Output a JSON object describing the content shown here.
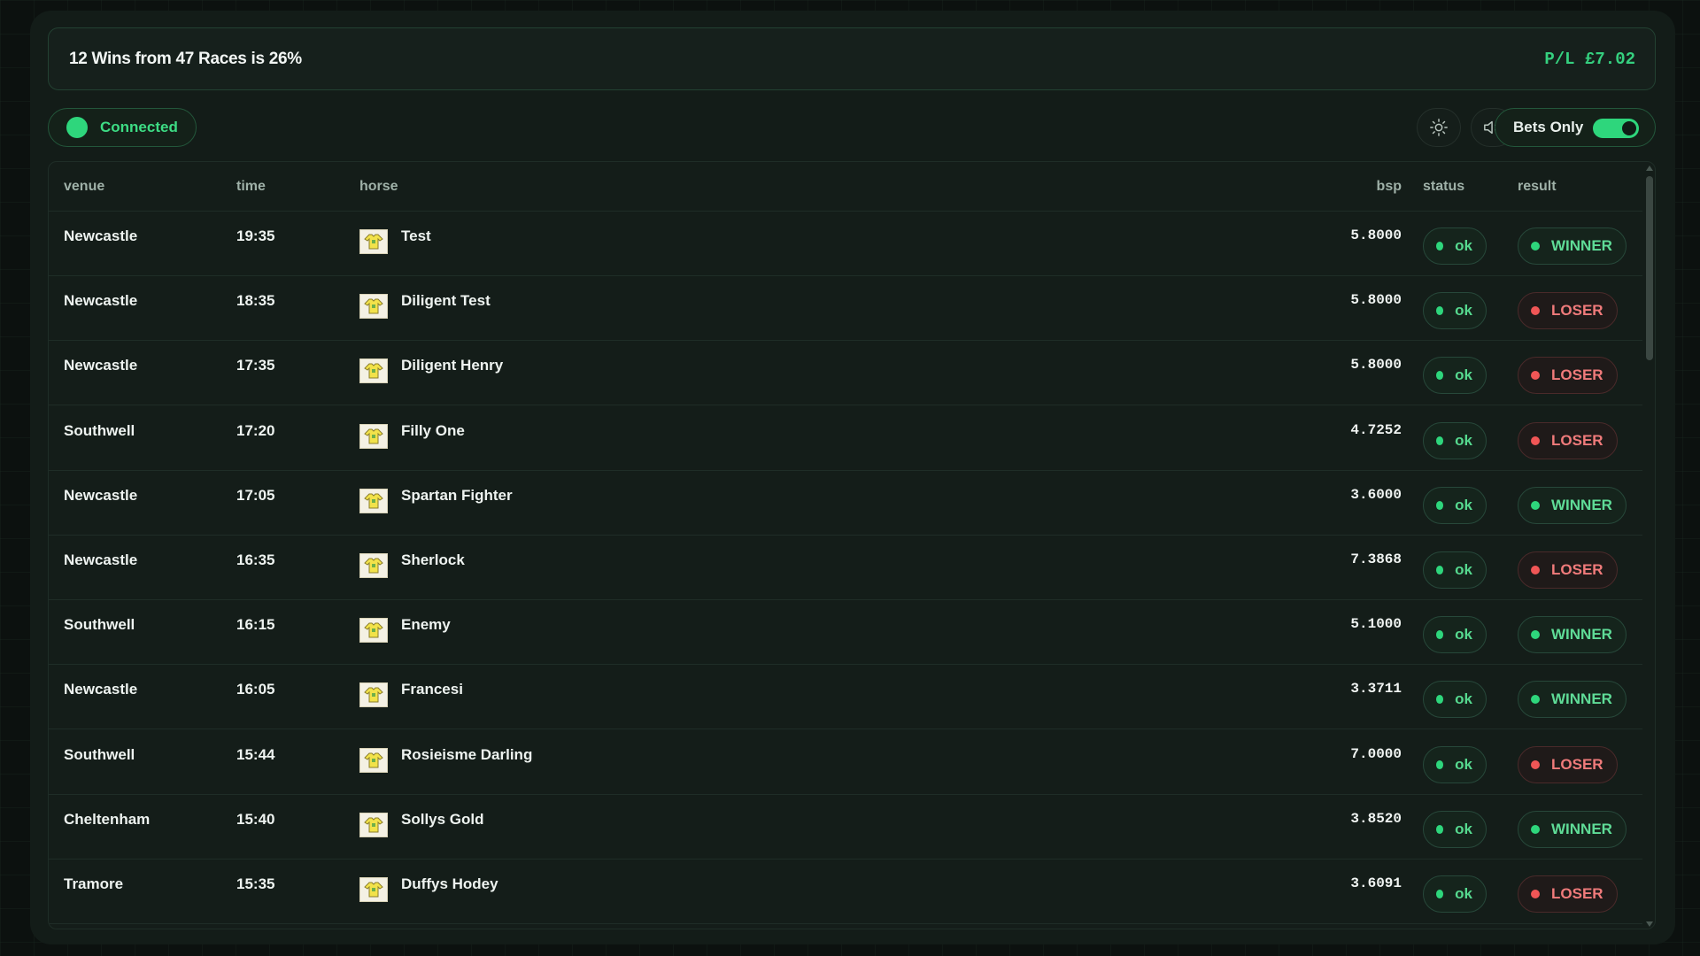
{
  "summary": {
    "title": "12 Wins from 47 Races is 26%",
    "pl": "P/L £7.02"
  },
  "toolbar": {
    "connection_label": "Connected",
    "brightness_icon": "sun-icon",
    "mute_icon": "speaker-muted-icon",
    "bets_only_label": "Bets Only",
    "bets_only_on": true
  },
  "table": {
    "headers": {
      "venue": "venue",
      "time": "time",
      "horse": "horse",
      "bsp": "bsp",
      "status": "status",
      "result": "result"
    },
    "rows": [
      {
        "venue": "Newcastle",
        "time": "19:35",
        "horse": "Test",
        "bsp": "5.8000",
        "status": "ok",
        "result": "WINNER"
      },
      {
        "venue": "Newcastle",
        "time": "18:35",
        "horse": "Diligent Test",
        "bsp": "5.8000",
        "status": "ok",
        "result": "LOSER"
      },
      {
        "venue": "Newcastle",
        "time": "17:35",
        "horse": "Diligent Henry",
        "bsp": "5.8000",
        "status": "ok",
        "result": "LOSER"
      },
      {
        "venue": "Southwell",
        "time": "17:20",
        "horse": "Filly One",
        "bsp": "4.7252",
        "status": "ok",
        "result": "LOSER"
      },
      {
        "venue": "Newcastle",
        "time": "17:05",
        "horse": "Spartan Fighter",
        "bsp": "3.6000",
        "status": "ok",
        "result": "WINNER"
      },
      {
        "venue": "Newcastle",
        "time": "16:35",
        "horse": "Sherlock",
        "bsp": "7.3868",
        "status": "ok",
        "result": "LOSER"
      },
      {
        "venue": "Southwell",
        "time": "16:15",
        "horse": "Enemy",
        "bsp": "5.1000",
        "status": "ok",
        "result": "WINNER"
      },
      {
        "venue": "Newcastle",
        "time": "16:05",
        "horse": "Francesi",
        "bsp": "3.3711",
        "status": "ok",
        "result": "WINNER"
      },
      {
        "venue": "Southwell",
        "time": "15:44",
        "horse": "Rosieisme Darling",
        "bsp": "7.0000",
        "status": "ok",
        "result": "LOSER"
      },
      {
        "venue": "Cheltenham",
        "time": "15:40",
        "horse": "Sollys Gold",
        "bsp": "3.8520",
        "status": "ok",
        "result": "WINNER"
      },
      {
        "venue": "Tramore",
        "time": "15:35",
        "horse": "Duffys Hodey",
        "bsp": "3.6091",
        "status": "ok",
        "result": "LOSER"
      }
    ]
  },
  "colors": {
    "accent": "#2ed67c",
    "winner": "#5fdc97",
    "loser": "#f07b7b",
    "panel": "#131c18"
  }
}
